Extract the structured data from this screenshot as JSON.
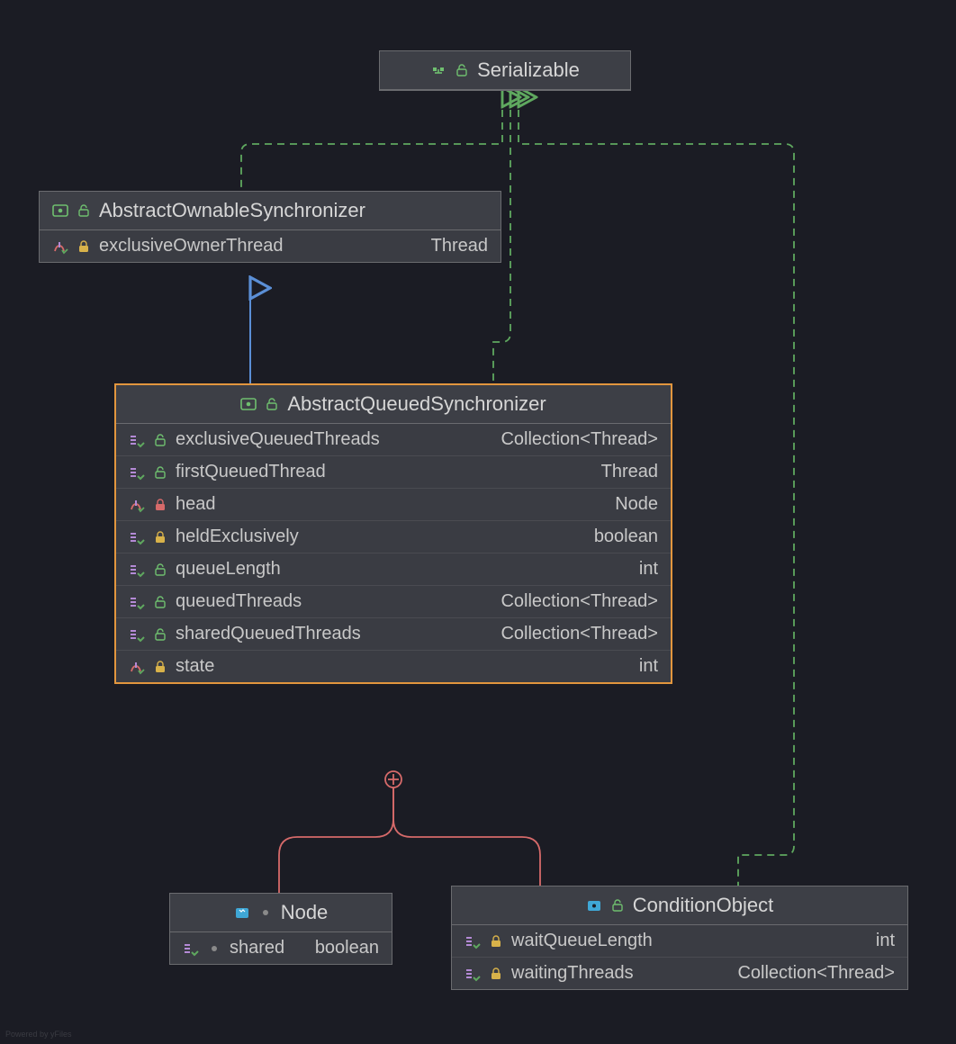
{
  "watermark": "Powered by yFiles",
  "serializable": {
    "title": "Serializable",
    "icon": "interface-icon",
    "lock": "public"
  },
  "aos": {
    "title": "AbstractOwnableSynchronizer",
    "icon": "abstract-class-icon",
    "lock": "public",
    "fields": [
      {
        "icon": "field-set-icon",
        "lock": "protected",
        "name": "exclusiveOwnerThread",
        "type": "Thread"
      }
    ]
  },
  "aqs": {
    "title": "AbstractQueuedSynchronizer",
    "icon": "abstract-class-icon",
    "lock": "public",
    "fields": [
      {
        "icon": "property-icon",
        "lock": "public",
        "name": "exclusiveQueuedThreads",
        "type": "Collection<Thread>"
      },
      {
        "icon": "property-icon",
        "lock": "public",
        "name": "firstQueuedThread",
        "type": "Thread"
      },
      {
        "icon": "field-set-icon",
        "lock": "private",
        "name": "head",
        "type": "Node"
      },
      {
        "icon": "property-icon",
        "lock": "protected",
        "name": "heldExclusively",
        "type": "boolean"
      },
      {
        "icon": "property-icon",
        "lock": "public",
        "name": "queueLength",
        "type": "int"
      },
      {
        "icon": "property-icon",
        "lock": "public",
        "name": "queuedThreads",
        "type": "Collection<Thread>"
      },
      {
        "icon": "property-icon",
        "lock": "public",
        "name": "sharedQueuedThreads",
        "type": "Collection<Thread>"
      },
      {
        "icon": "field-set-icon",
        "lock": "protected",
        "name": "state",
        "type": "int"
      }
    ]
  },
  "node": {
    "title": "Node",
    "icon": "static-class-icon",
    "lock": "package",
    "fields": [
      {
        "icon": "property-icon",
        "lock": "package",
        "name": "shared",
        "type": "boolean"
      }
    ]
  },
  "cond": {
    "title": "ConditionObject",
    "icon": "class-icon",
    "lock": "public",
    "fields": [
      {
        "icon": "property-icon",
        "lock": "protected",
        "name": "waitQueueLength",
        "type": "int"
      },
      {
        "icon": "property-icon",
        "lock": "protected",
        "name": "waitingThreads",
        "type": "Collection<Thread>"
      }
    ]
  }
}
